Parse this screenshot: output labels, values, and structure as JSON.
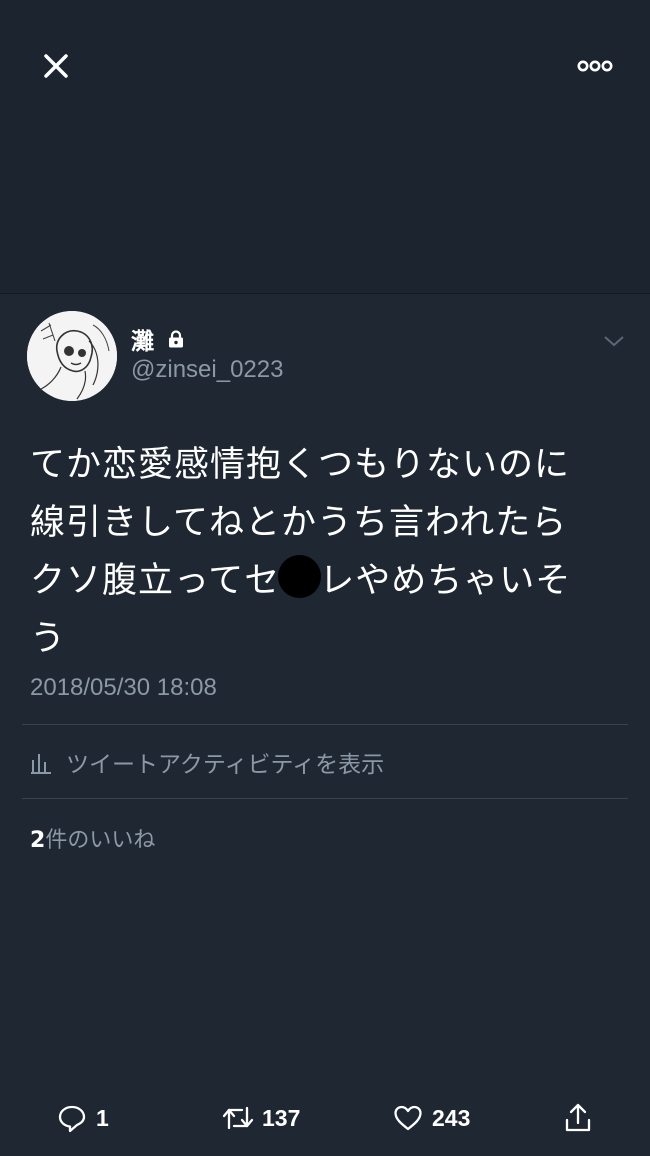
{
  "header": {
    "close_icon": "close-icon",
    "more_icon": "more-horizontal-icon"
  },
  "tweet": {
    "author_name": "灘",
    "author_handle": "@zinsei_0223",
    "text_lines": [
      "てか恋愛感情抱くつもりないのに",
      "線引きしてねとかうち言われたら",
      "クソ腹立ってセ",
      "レやめちゃいそ",
      "う"
    ],
    "timestamp": "2018/05/30 18:08",
    "activity_label": "ツイートアクティビティを表示",
    "likes_count": "2",
    "likes_label": "件のいいね"
  },
  "actions": {
    "reply_count": "1",
    "retweet_count": "137",
    "like_count": "243"
  },
  "colors": {
    "background": "#1f2732",
    "muted": "#8b98a5",
    "divider": "#38444d"
  }
}
